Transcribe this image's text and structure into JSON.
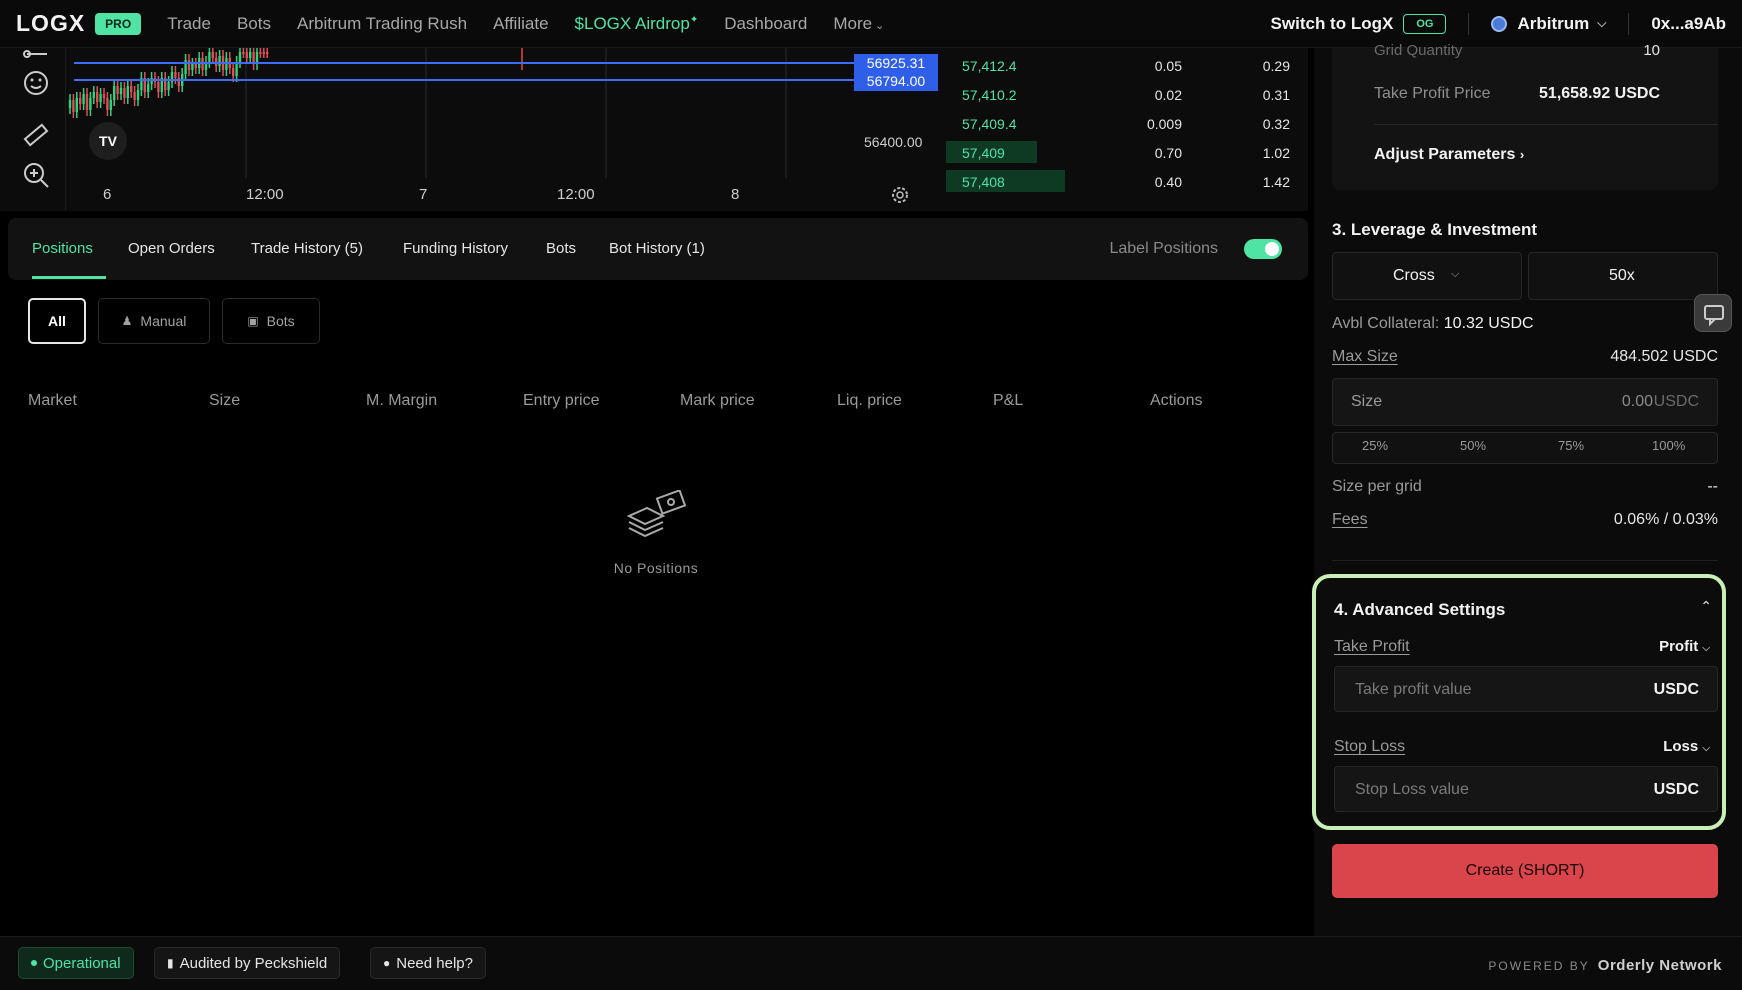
{
  "nav": {
    "logo": "LOGX",
    "pro_badge": "PRO",
    "items": [
      "Trade",
      "Bots",
      "Arbitrum Trading Rush",
      "Affiliate",
      "$LOGX Airdrop",
      "Dashboard",
      "More"
    ],
    "switch_label": "Switch to LogX",
    "og_badge": "OG",
    "chain": "Arbitrum",
    "wallet": "0x...a9Ab"
  },
  "chart": {
    "price_tags": [
      "56925.31",
      "56794.00"
    ],
    "axis_price": "56400.00",
    "time_labels": [
      "6",
      "12:00",
      "7",
      "12:00",
      "8"
    ],
    "tv_logo": "TV",
    "line_color": "#3f6cff"
  },
  "orderbook": {
    "rows": [
      {
        "price": "57,412.4",
        "qty": "0.05",
        "total": "0.29",
        "depth": 0.0
      },
      {
        "price": "57,410.2",
        "qty": "0.02",
        "total": "0.31",
        "depth": 0.0
      },
      {
        "price": "57,409.4",
        "qty": "0.009",
        "total": "0.32",
        "depth": 0.0
      },
      {
        "price": "57,409",
        "qty": "0.70",
        "total": "1.02",
        "depth": 0.25
      },
      {
        "price": "57,408",
        "qty": "0.40",
        "total": "1.42",
        "depth": 0.33
      }
    ]
  },
  "positions": {
    "tabs": [
      "Positions",
      "Open Orders",
      "Trade History (5)",
      "Funding History",
      "Bots",
      "Bot History (1)"
    ],
    "label_positions": "Label Positions",
    "label_positions_on": true,
    "filters": [
      "All",
      "Manual",
      "Bots"
    ],
    "columns": [
      "Market",
      "Size",
      "M. Margin",
      "Entry price",
      "Mark price",
      "Liq. price",
      "P&L",
      "Actions"
    ],
    "empty_text": "No Positions"
  },
  "side": {
    "grid_quantity_label": "Grid Quantity",
    "grid_quantity_value": "10",
    "take_profit_price_label": "Take Profit Price",
    "take_profit_price_value": "51,658.92 USDC",
    "adjust_parameters": "Adjust Parameters",
    "leverage_title": "3. Leverage & Investment",
    "margin_mode": "Cross",
    "leverage": "50x",
    "avbl_collateral_label": "Avbl Collateral:",
    "avbl_collateral_value": "10.32 USDC",
    "max_size_label": "Max Size",
    "max_size_value": "484.502 USDC",
    "size_label": "Size",
    "size_value": "0.00",
    "size_unit": "USDC",
    "pcts": [
      "25%",
      "50%",
      "75%",
      "100%"
    ],
    "size_per_grid_label": "Size per grid",
    "size_per_grid_value": "--",
    "fees_label": "Fees",
    "fees_value": "0.06% / 0.03%",
    "advanced_title": "4. Advanced Settings",
    "take_profit_label": "Take Profit",
    "take_profit_select": "Profit",
    "take_profit_placeholder": "Take profit value",
    "take_profit_unit": "USDC",
    "stop_loss_label": "Stop Loss",
    "stop_loss_select": "Loss",
    "stop_loss_placeholder": "Stop Loss value",
    "stop_loss_unit": "USDC",
    "create_button": "Create (SHORT)",
    "create_color": "#d9454b"
  },
  "footer": {
    "status": "Operational",
    "audited": "Audited by Peckshield",
    "help": "Need help?",
    "powered_by": "POWERED BY",
    "network": "Orderly Network"
  }
}
